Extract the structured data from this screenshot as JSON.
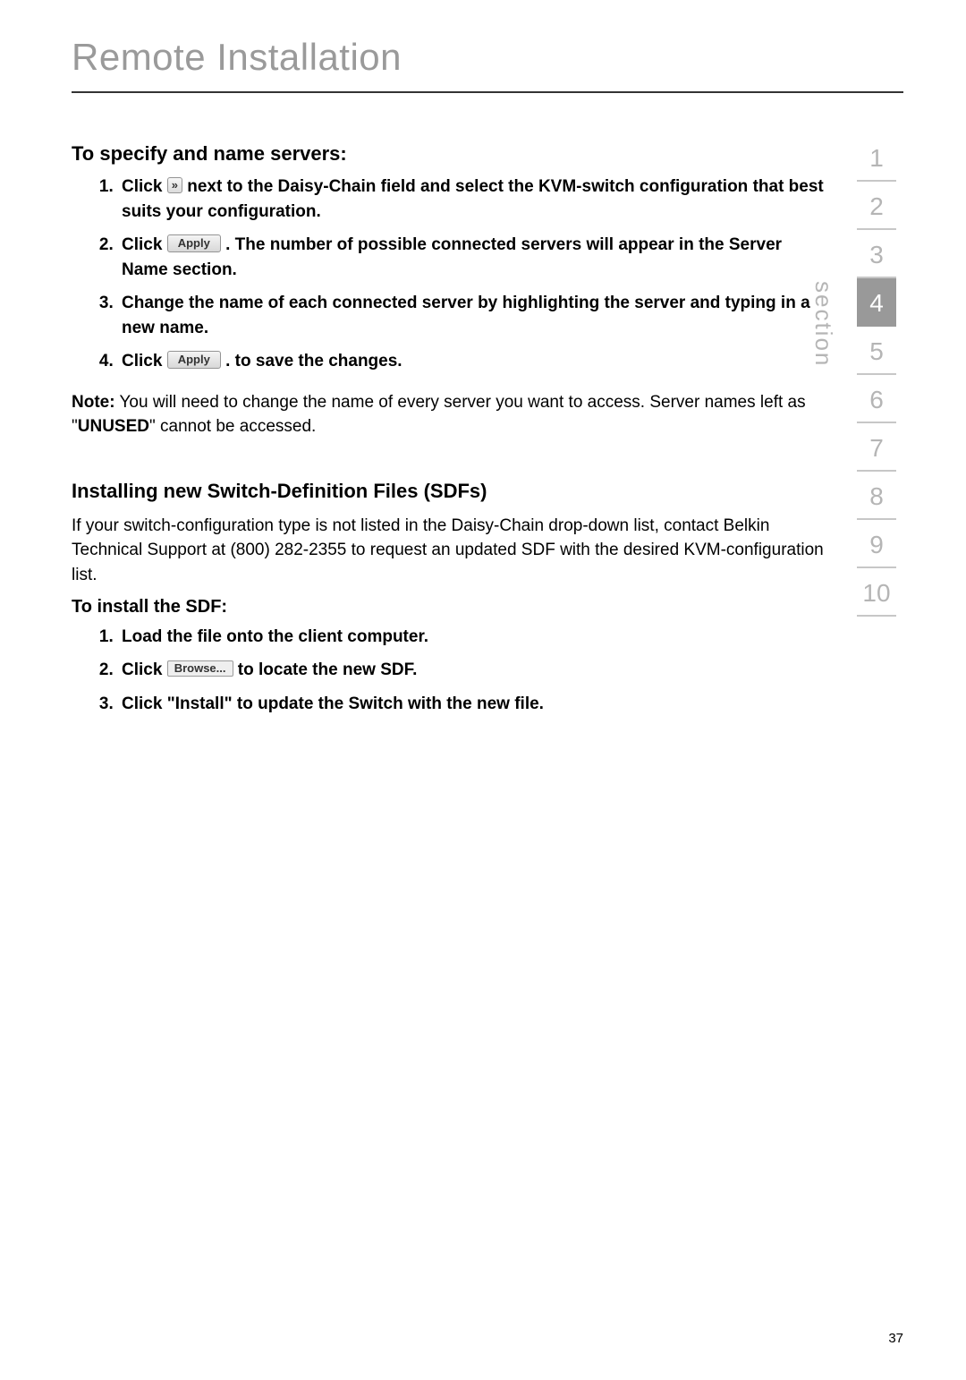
{
  "page_title": "Remote Installation",
  "section_label": "section",
  "section_nav": [
    "1",
    "2",
    "3",
    "4",
    "5",
    "6",
    "7",
    "8",
    "9",
    "10"
  ],
  "active_section_index": 3,
  "heading_a": "To specify and name servers:",
  "steps_a": {
    "s1_a": "Click ",
    "s1_b": " next to the Daisy-Chain field and select the KVM-switch configuration that best suits your configuration.",
    "s2_a": "Click ",
    "s2_b": ". The number of possible connected servers will appear in the Server Name section.",
    "s3": "Change the name of each connected server by highlighting the server and typing in a new name.",
    "s4_a": "Click ",
    "s4_b": ". to save the changes."
  },
  "note_label": "Note:",
  "note_body_a": " You will need to change the name of every server you want to access. Server names left as \"",
  "note_unused": "UNUSED",
  "note_body_b": "\" cannot be accessed.",
  "heading_b": "Installing new Switch-Definition Files (SDFs)",
  "para_b": "If your switch-configuration type is not listed in the Daisy-Chain drop-down list, contact Belkin Technical Support at (800) 282-2355 to request an updated SDF with the desired KVM-configuration list.",
  "heading_c": "To install the SDF:",
  "steps_c": {
    "s1": "Load the file onto the client computer.",
    "s2_a": "Click ",
    "s2_b": " to locate the new SDF.",
    "s3": "Click \"Install\" to update the Switch with the new file."
  },
  "btn_apply": "Apply",
  "btn_browse": "Browse...",
  "chevron": "»",
  "page_number": "37"
}
